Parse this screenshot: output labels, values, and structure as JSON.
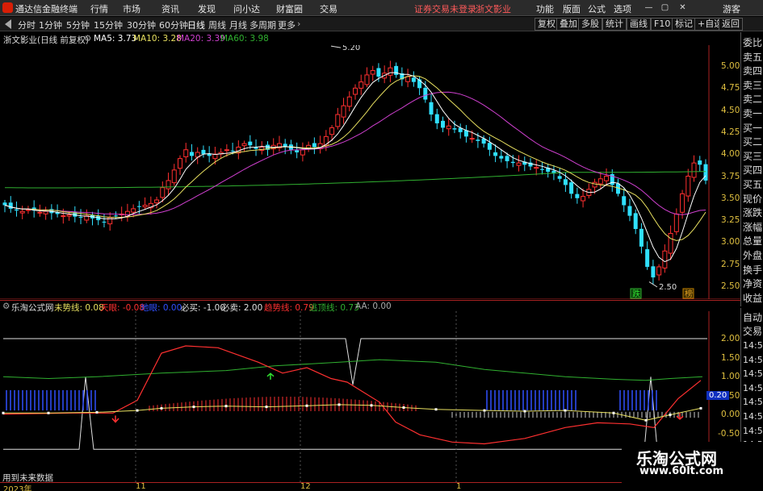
{
  "menubar": {
    "app_title": "通达信金融终端",
    "items": [
      "行情",
      "市场",
      "资讯",
      "发现",
      "问小达",
      "财富圈",
      "交易"
    ],
    "status": "证券交易未登录",
    "stock_name": "浙文影业",
    "right_items": [
      "功能",
      "版面",
      "公式",
      "选项"
    ],
    "guest": "游客"
  },
  "toolbar": {
    "periods": [
      "分时",
      "1分钟",
      "5分钟",
      "15分钟",
      "30分钟",
      "60分钟",
      "日线",
      "周线",
      "月线",
      "多周期",
      "更多"
    ],
    "active_period": "日线",
    "right_buttons": [
      "复权",
      "叠加",
      "多股",
      "统计",
      "画线",
      "F10",
      "标记",
      "+自选",
      "返回"
    ]
  },
  "main_legend": {
    "title": "浙文影业(日线 前复权)",
    "ma5_label": "MA5: 3.73",
    "ma10_label": "MA10: 3.28",
    "ma20_label": "MA20: 3.39",
    "ma60_label": "MA60: 3.98"
  },
  "colors": {
    "ma5": "#ffffff",
    "ma10": "#e8e060",
    "ma20": "#d040d0",
    "ma60": "#30b030",
    "up": "#ff3030",
    "down": "#30e0ff",
    "axis_text": "#e0c040"
  },
  "price_axis": [
    "5.00",
    "4.75",
    "4.50",
    "4.25",
    "4.00",
    "3.75",
    "3.50",
    "3.25",
    "3.00",
    "2.75",
    "2.50"
  ],
  "annotations": {
    "high_label": "5.20",
    "low_label": "2.50",
    "tag_fall": "跌",
    "tag_top": "榜"
  },
  "right_panel": [
    "委比",
    "卖五",
    "卖四",
    "卖三",
    "卖二",
    "卖一",
    "买一",
    "买二",
    "买三",
    "买四",
    "买五",
    "现价",
    "涨跌",
    "涨幅",
    "总量",
    "外盘",
    "换手",
    "净资",
    "收益"
  ],
  "indicator_legend": {
    "name": "乐淘公式网",
    "items": [
      {
        "label": "未势线: 0.08",
        "color": "#e8e060"
      },
      {
        "label": "天眼: -0.08",
        "color": "#ff3030"
      },
      {
        "label": "地眼: 0.00",
        "color": "#3050ff"
      },
      {
        "label": "必买: -1.00",
        "color": "#e0e0e0"
      },
      {
        "label": "必卖: 2.00",
        "color": "#e0e0e0"
      },
      {
        "label": "趋势线: 0.79",
        "color": "#ff3030"
      },
      {
        "label": "逃顶线: 0.73",
        "color": "#30b030"
      },
      {
        "label": "AA: 0.00",
        "color": "#aaaaaa"
      }
    ]
  },
  "indicator_axis": [
    "2.00",
    "1.50",
    "1.00",
    "0.50",
    "0.00",
    "-0.50"
  ],
  "indicator_highlight": "0.20",
  "right_panel2": {
    "heads": [
      "自动",
      "交易"
    ],
    "times": [
      "14:56",
      "14:56",
      "14:56",
      "14:56",
      "14:56",
      "14:56",
      "14:56",
      "14:56",
      "14:56",
      "14:56"
    ]
  },
  "future_label": "用到未来数据",
  "date_axis": [
    "2023年",
    "11",
    "12",
    "1"
  ],
  "watermark": {
    "title": "乐淘公式网",
    "url": "www.60lt.com"
  }
}
